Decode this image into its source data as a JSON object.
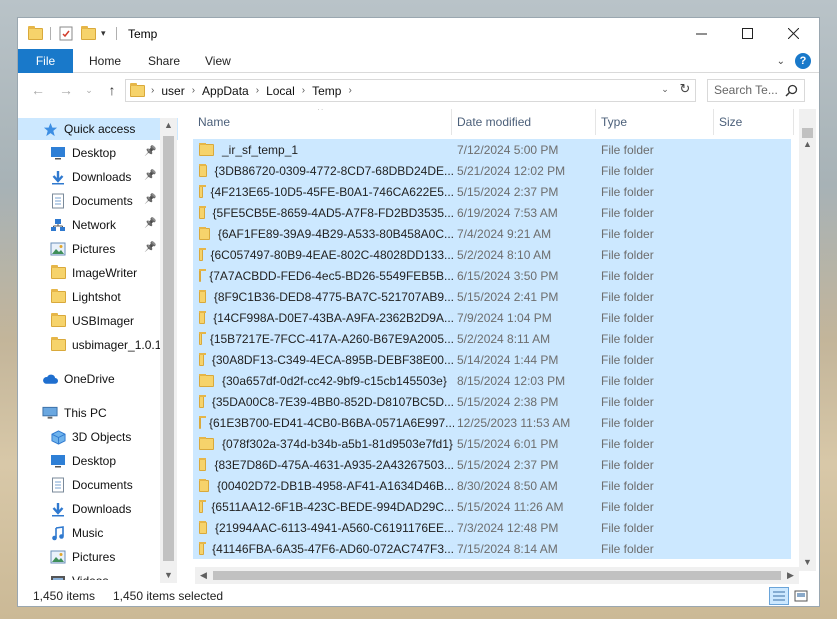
{
  "window": {
    "title": "Temp"
  },
  "ribbon": {
    "tabs": [
      "File",
      "Home",
      "Share",
      "View"
    ]
  },
  "address": {
    "crumbs": [
      "user",
      "AppData",
      "Local",
      "Temp"
    ],
    "search_placeholder": "Search Te..."
  },
  "nav": {
    "items": [
      {
        "label": "Quick access",
        "icon": "star-icon",
        "indent": 0,
        "selected": true,
        "pinned": false
      },
      {
        "label": "Desktop",
        "icon": "desktop-icon",
        "indent": 1,
        "pinned": true
      },
      {
        "label": "Downloads",
        "icon": "download-icon",
        "indent": 1,
        "pinned": true
      },
      {
        "label": "Documents",
        "icon": "documents-icon",
        "indent": 1,
        "pinned": true
      },
      {
        "label": "Network",
        "icon": "network-icon",
        "indent": 1,
        "pinned": true
      },
      {
        "label": "Pictures",
        "icon": "pictures-icon",
        "indent": 1,
        "pinned": true
      },
      {
        "label": "ImageWriter",
        "icon": "folder-icon",
        "indent": 1,
        "pinned": false
      },
      {
        "label": "Lightshot",
        "icon": "folder-icon",
        "indent": 1,
        "pinned": false
      },
      {
        "label": "USBImager",
        "icon": "folder-icon",
        "indent": 1,
        "pinned": false
      },
      {
        "label": "usbimager_1.0.1",
        "icon": "folder-icon",
        "indent": 1,
        "pinned": false
      },
      {
        "label": "OneDrive",
        "icon": "cloud-icon",
        "indent": 0,
        "pinned": false,
        "gap": true
      },
      {
        "label": "This PC",
        "icon": "pc-icon",
        "indent": 0,
        "pinned": false,
        "gap": true
      },
      {
        "label": "3D Objects",
        "icon": "cube-icon",
        "indent": 1,
        "pinned": false
      },
      {
        "label": "Desktop",
        "icon": "desktop-icon",
        "indent": 1,
        "pinned": false
      },
      {
        "label": "Documents",
        "icon": "documents-icon",
        "indent": 1,
        "pinned": false
      },
      {
        "label": "Downloads",
        "icon": "download-icon",
        "indent": 1,
        "pinned": false
      },
      {
        "label": "Music",
        "icon": "music-icon",
        "indent": 1,
        "pinned": false
      },
      {
        "label": "Pictures",
        "icon": "pictures-icon",
        "indent": 1,
        "pinned": false
      },
      {
        "label": "Videos",
        "icon": "videos-icon",
        "indent": 1,
        "pinned": false
      }
    ]
  },
  "columns": [
    "Name",
    "Date modified",
    "Type",
    "Size"
  ],
  "files": [
    {
      "name": "_ir_sf_temp_1",
      "date": "7/12/2024 5:00 PM",
      "type": "File folder"
    },
    {
      "name": "{3DB86720-0309-4772-8CD7-68DBD24DE...",
      "date": "5/21/2024 12:02 PM",
      "type": "File folder"
    },
    {
      "name": "{4F213E65-10D5-45FE-B0A1-746CA622E5...",
      "date": "5/15/2024 2:37 PM",
      "type": "File folder"
    },
    {
      "name": "{5FE5CB5E-8659-4AD5-A7F8-FD2BD3535...",
      "date": "6/19/2024 7:53 AM",
      "type": "File folder"
    },
    {
      "name": "{6AF1FE89-39A9-4B29-A533-80B458A0C...",
      "date": "7/4/2024 9:21 AM",
      "type": "File folder"
    },
    {
      "name": "{6C057497-80B9-4EAE-802C-48028DD133...",
      "date": "5/2/2024 8:10 AM",
      "type": "File folder"
    },
    {
      "name": "{7A7ACBDD-FED6-4ec5-BD26-5549FEB5B...",
      "date": "6/15/2024 3:50 PM",
      "type": "File folder"
    },
    {
      "name": "{8F9C1B36-DED8-4775-BA7C-521707AB9...",
      "date": "5/15/2024 2:41 PM",
      "type": "File folder"
    },
    {
      "name": "{14CF998A-D0E7-43BA-A9FA-2362B2D9A...",
      "date": "7/9/2024 1:04 PM",
      "type": "File folder"
    },
    {
      "name": "{15B7217E-7FCC-417A-A260-B67E9A2005...",
      "date": "5/2/2024 8:11 AM",
      "type": "File folder"
    },
    {
      "name": "{30A8DF13-C349-4ECA-895B-DEBF38E00...",
      "date": "5/14/2024 1:44 PM",
      "type": "File folder"
    },
    {
      "name": "{30a657df-0d2f-cc42-9bf9-c15cb145503e}",
      "date": "8/15/2024 12:03 PM",
      "type": "File folder"
    },
    {
      "name": "{35DA00C8-7E39-4BB0-852D-D8107BC5D...",
      "date": "5/15/2024 2:38 PM",
      "type": "File folder"
    },
    {
      "name": "{61E3B700-ED41-4CB0-B6BA-0571A6E997...",
      "date": "12/25/2023 11:53 AM",
      "type": "File folder"
    },
    {
      "name": "{078f302a-374d-b34b-a5b1-81d9503e7fd1}",
      "date": "5/15/2024 6:01 PM",
      "type": "File folder"
    },
    {
      "name": "{83E7D86D-475A-4631-A935-2A43267503...",
      "date": "5/15/2024 2:37 PM",
      "type": "File folder"
    },
    {
      "name": "{00402D72-DB1B-4958-AF41-A1634D46B...",
      "date": "8/30/2024 8:50 AM",
      "type": "File folder"
    },
    {
      "name": "{6511AA12-6F1B-423C-BEDE-994DAD29C...",
      "date": "5/15/2024 11:26 AM",
      "type": "File folder"
    },
    {
      "name": "{21994AAC-6113-4941-A560-C6191176EE...",
      "date": "7/3/2024 12:48 PM",
      "type": "File folder"
    },
    {
      "name": "{41146FBA-6A35-47F6-AD60-072AC747F3...",
      "date": "7/15/2024 8:14 AM",
      "type": "File folder"
    }
  ],
  "status": {
    "count": "1,450 items",
    "selected": "1,450 items selected"
  },
  "colors": {
    "accent": "#1979ca",
    "selection": "#cce8ff",
    "folder": "#f6d36b"
  }
}
